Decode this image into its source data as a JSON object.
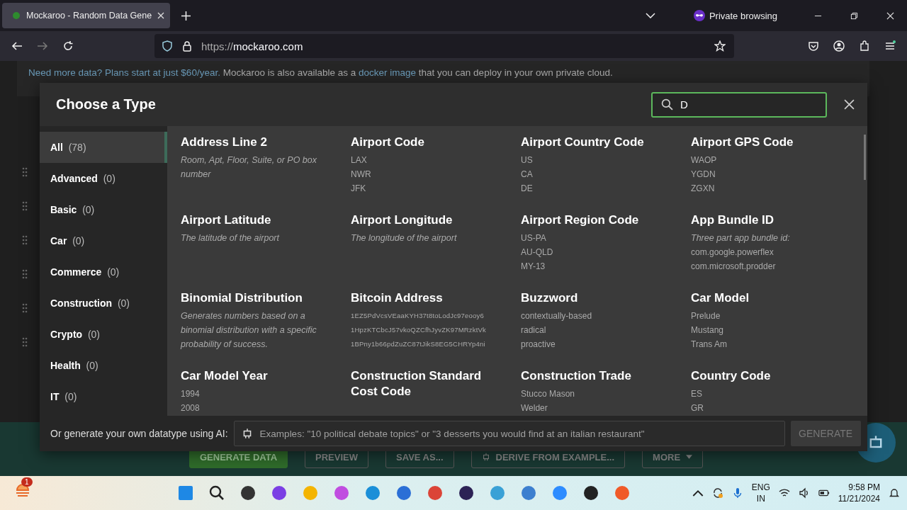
{
  "browser": {
    "tab_title": "Mockaroo - Random Data Gene",
    "url_scheme": "https://",
    "url_host": "mockaroo.com",
    "private_label": "Private browsing"
  },
  "page": {
    "notice": [
      {
        "text": "Need more data? Plans start at just $60/year.",
        "link": true
      },
      {
        "text": " Mockaroo is also available as a ",
        "link": false
      },
      {
        "text": "docker image",
        "link": true
      },
      {
        "text": " that you can deploy in your own private cloud.",
        "link": false
      }
    ],
    "buttons": [
      {
        "label": "GENERATE DATA",
        "kind": "primary"
      },
      {
        "label": "PREVIEW",
        "kind": "outline"
      },
      {
        "label": "SAVE AS...",
        "kind": "outline"
      },
      {
        "label": "DERIVE FROM EXAMPLE...",
        "kind": "robot"
      },
      {
        "label": "MORE",
        "kind": "menu"
      }
    ]
  },
  "modal": {
    "title": "Choose a Type",
    "search": {
      "value": "D"
    },
    "categories": [
      {
        "label": "All",
        "count": "(78)",
        "selected": true
      },
      {
        "label": "Advanced",
        "count": "(0)",
        "selected": false
      },
      {
        "label": "Basic",
        "count": "(0)",
        "selected": false
      },
      {
        "label": "Car",
        "count": "(0)",
        "selected": false
      },
      {
        "label": "Commerce",
        "count": "(0)",
        "selected": false
      },
      {
        "label": "Construction",
        "count": "(0)",
        "selected": false
      },
      {
        "label": "Crypto",
        "count": "(0)",
        "selected": false
      },
      {
        "label": "Health",
        "count": "(0)",
        "selected": false
      },
      {
        "label": "IT",
        "count": "(0)",
        "selected": false
      }
    ],
    "types": [
      {
        "name": "Address Line 2",
        "description": "Room, Apt, Floor, Suite, or PO box number"
      },
      {
        "name": "Airport Code",
        "examples": [
          "LAX",
          "NWR",
          "JFK"
        ]
      },
      {
        "name": "Airport Country Code",
        "examples": [
          "US",
          "CA",
          "DE"
        ]
      },
      {
        "name": "Airport GPS Code",
        "examples": [
          "WAOP",
          "YGDN",
          "ZGXN"
        ]
      },
      {
        "name": "Airport Latitude",
        "description": "The latitude of the airport"
      },
      {
        "name": "Airport Longitude",
        "description": "The longitude of the airport"
      },
      {
        "name": "Airport Region Code",
        "examples": [
          "US-PA",
          "AU-QLD",
          "MY-13"
        ]
      },
      {
        "name": "App Bundle ID",
        "description": "Three part app bundle id:",
        "examples": [
          "com.google.powerflex",
          "com.microsoft.prodder"
        ]
      },
      {
        "name": "Binomial Distribution",
        "description": "Generates numbers based on a binomial distribution with a specific probability of success."
      },
      {
        "name": "Bitcoin Address",
        "examples": [
          "1EZ5PdVcsVEaaKYH37t8toLodJc97eooy6",
          "1HpzKTCbcJ57vkoQZCfhJyvZK97MRzktVk",
          "1BPny1b66pdZuZC87tJikS8EG5CHRYp4ni"
        ]
      },
      {
        "name": "Buzzword",
        "examples": [
          "contextually-based",
          "radical",
          "proactive"
        ]
      },
      {
        "name": "Car Model",
        "examples": [
          "Prelude",
          "Mustang",
          "Trans Am"
        ]
      },
      {
        "name": "Car Model Year",
        "examples": [
          "1994",
          "2008"
        ]
      },
      {
        "name": "Construction Standard Cost Code"
      },
      {
        "name": "Construction Trade",
        "examples": [
          "Stucco Mason",
          "Welder"
        ]
      },
      {
        "name": "Country Code",
        "examples": [
          "ES",
          "GR"
        ]
      }
    ],
    "ai_label": "Or generate your own datatype using AI:",
    "ai_placeholder": "Examples: \"10 political debate topics\" or \"3 desserts you would find at an italian restaurant\"",
    "generate_button": {
      "label": "GENERATE",
      "disabled": true
    }
  },
  "taskbar": {
    "notification_count": "1",
    "language": "ENG",
    "region": "IN",
    "time": "9:58 PM",
    "date": "11/21/2024"
  }
}
